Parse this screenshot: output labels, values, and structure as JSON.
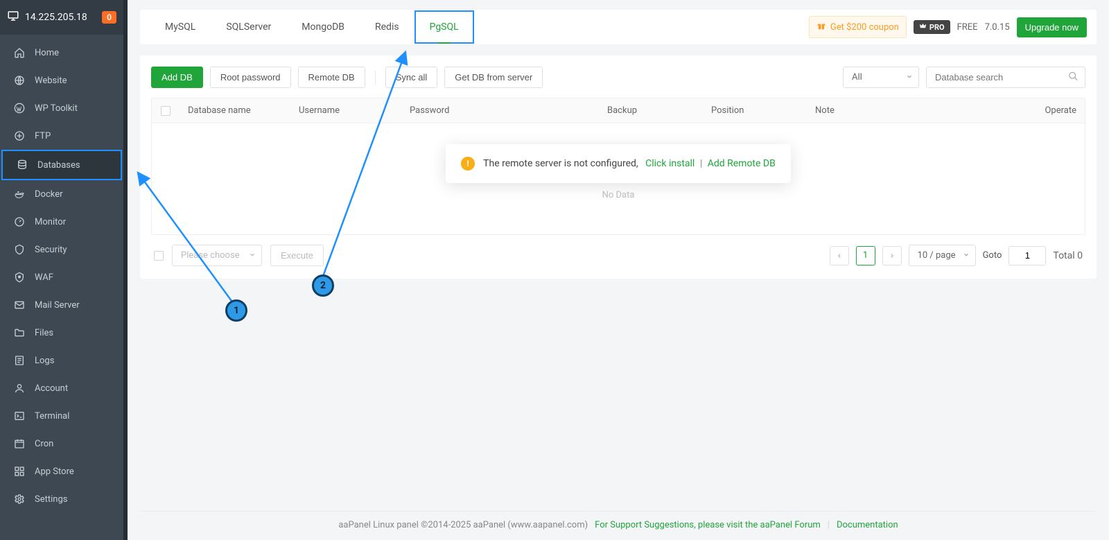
{
  "header": {
    "ip": "14.225.205.18",
    "alerts": "0"
  },
  "sidebar": [
    {
      "icon": "home",
      "label": "Home"
    },
    {
      "icon": "website",
      "label": "Website"
    },
    {
      "icon": "wp",
      "label": "WP Toolkit"
    },
    {
      "icon": "ftp",
      "label": "FTP"
    },
    {
      "icon": "db",
      "label": "Databases",
      "active": true
    },
    {
      "icon": "docker",
      "label": "Docker"
    },
    {
      "icon": "monitor",
      "label": "Monitor"
    },
    {
      "icon": "security",
      "label": "Security"
    },
    {
      "icon": "waf",
      "label": "WAF"
    },
    {
      "icon": "mail",
      "label": "Mail Server"
    },
    {
      "icon": "files",
      "label": "Files"
    },
    {
      "icon": "logs",
      "label": "Logs"
    },
    {
      "icon": "account",
      "label": "Account"
    },
    {
      "icon": "terminal",
      "label": "Terminal"
    },
    {
      "icon": "cron",
      "label": "Cron"
    },
    {
      "icon": "appstore",
      "label": "App Store"
    },
    {
      "icon": "settings",
      "label": "Settings"
    }
  ],
  "tabs": {
    "items": [
      "MySQL",
      "SQLServer",
      "MongoDB",
      "Redis",
      "PgSQL"
    ],
    "active": 4,
    "coupon": "Get $200 coupon",
    "pro": "PRO",
    "free": "FREE",
    "version": "7.0.15",
    "upgrade": "Upgrade now"
  },
  "toolbar": {
    "add": "Add DB",
    "root": "Root password",
    "remote": "Remote DB",
    "sync": "Sync all",
    "fromServer": "Get DB from server",
    "filter": "All",
    "searchPlaceholder": "Database search"
  },
  "table": {
    "cols": {
      "name": "Database name",
      "user": "Username",
      "pass": "Password",
      "backup": "Backup",
      "pos": "Position",
      "note": "Note",
      "op": "Operate"
    },
    "noData": "No Data",
    "notice": "The remote server is not configured,",
    "clickInstall": "Click install",
    "addRemote": "Add Remote DB"
  },
  "tfoot": {
    "choosePlaceholder": "Please choose",
    "execute": "Execute",
    "perPage": "10 / page",
    "goto": "Goto",
    "gotoVal": "1",
    "page": "1",
    "total": "Total 0"
  },
  "footer": {
    "copyright": "aaPanel Linux panel ©2014-2025 aaPanel (www.aapanel.com)",
    "support": "For Support Suggestions, please visit the aaPanel Forum",
    "docs": "Documentation"
  },
  "annotations": {
    "one": "1",
    "two": "2"
  }
}
